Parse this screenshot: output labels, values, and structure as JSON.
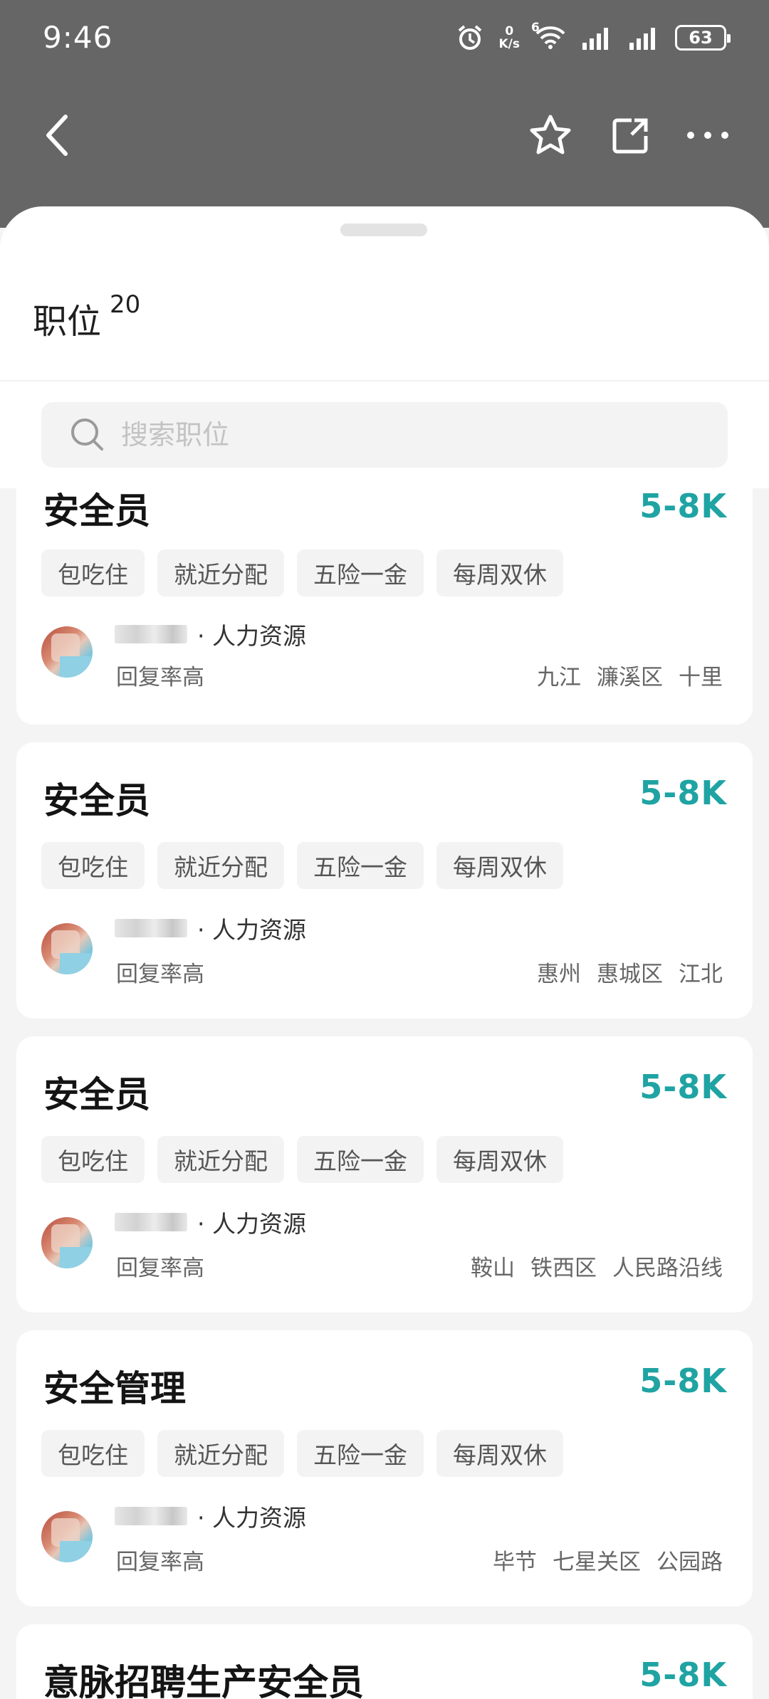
{
  "status_bar": {
    "time": "9:46",
    "net_speed_value": "0",
    "net_speed_unit": "K/s",
    "wifi_generation": "6",
    "battery": "63"
  },
  "nav": {
    "back_icon": "chevron-left-icon",
    "favorite_icon": "star-icon",
    "share_icon": "share-icon",
    "more_icon": "more-horizontal-icon"
  },
  "sheet": {
    "title": "职位",
    "count": "20",
    "search_placeholder": "搜索职位"
  },
  "jobs": [
    {
      "title": "安全员",
      "salary": "5-8K",
      "tags": [
        "包吃住",
        "就近分配",
        "五险一金",
        "每周双休"
      ],
      "recruiter_role": "· 人力资源",
      "reply_rate": "回复率高",
      "location": [
        "九江",
        "濂溪区",
        "十里"
      ]
    },
    {
      "title": "安全员",
      "salary": "5-8K",
      "tags": [
        "包吃住",
        "就近分配",
        "五险一金",
        "每周双休"
      ],
      "recruiter_role": "· 人力资源",
      "reply_rate": "回复率高",
      "location": [
        "惠州",
        "惠城区",
        "江北"
      ]
    },
    {
      "title": "安全员",
      "salary": "5-8K",
      "tags": [
        "包吃住",
        "就近分配",
        "五险一金",
        "每周双休"
      ],
      "recruiter_role": "· 人力资源",
      "reply_rate": "回复率高",
      "location": [
        "鞍山",
        "铁西区",
        "人民路沿线"
      ]
    },
    {
      "title": "安全管理",
      "salary": "5-8K",
      "tags": [
        "包吃住",
        "就近分配",
        "五险一金",
        "每周双休"
      ],
      "recruiter_role": "· 人力资源",
      "reply_rate": "回复率高",
      "location": [
        "毕节",
        "七星关区",
        "公园路"
      ]
    },
    {
      "title": "意脉招聘生产安全员",
      "salary": "5-8K"
    }
  ],
  "colors": {
    "salary": "#1fa3a3",
    "overlay": "#666666",
    "tag_bg": "#f3f3f4"
  }
}
